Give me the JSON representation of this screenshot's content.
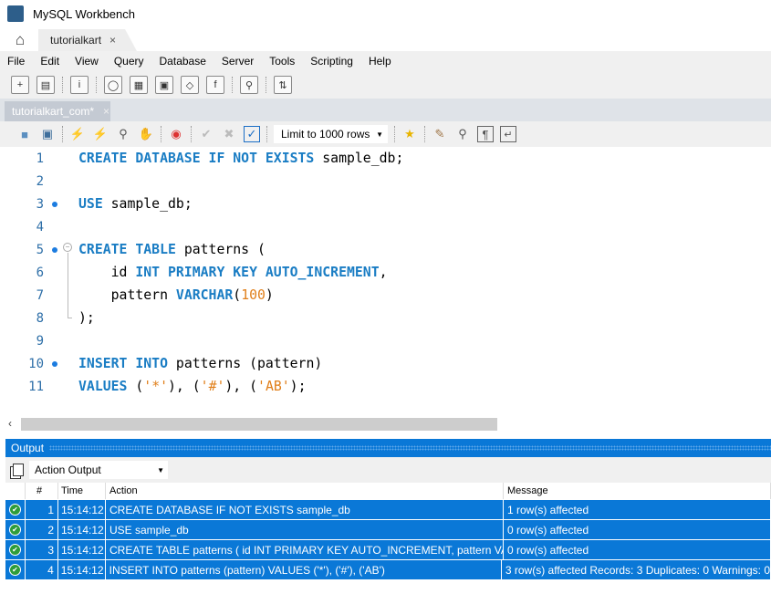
{
  "window": {
    "title": "MySQL Workbench"
  },
  "connection_tab": {
    "label": "tutorialkart",
    "close": "×"
  },
  "menu": [
    "File",
    "Edit",
    "View",
    "Query",
    "Database",
    "Server",
    "Tools",
    "Scripting",
    "Help"
  ],
  "editor_tab": {
    "label": "tutorialkart_com*",
    "close": "×"
  },
  "query_toolbar": {
    "limit_select": "Limit to 1000 rows"
  },
  "editor": {
    "lines": [
      {
        "n": "1",
        "bp": false,
        "tokens": [
          [
            "CREATE DATABASE IF NOT EXISTS",
            "kw"
          ],
          [
            " sample_db;",
            ""
          ]
        ]
      },
      {
        "n": "2",
        "bp": false,
        "tokens": []
      },
      {
        "n": "3",
        "bp": true,
        "tokens": [
          [
            "USE",
            "kw"
          ],
          [
            " sample_db;",
            ""
          ]
        ]
      },
      {
        "n": "4",
        "bp": false,
        "tokens": []
      },
      {
        "n": "5",
        "bp": true,
        "tokens": [
          [
            "CREATE TABLE",
            "kw"
          ],
          [
            " patterns (",
            ""
          ]
        ]
      },
      {
        "n": "6",
        "bp": false,
        "tokens": [
          [
            "    id ",
            ""
          ],
          [
            "INT PRIMARY KEY AUTO_INCREMENT",
            "kw"
          ],
          [
            ",",
            ""
          ]
        ]
      },
      {
        "n": "7",
        "bp": false,
        "tokens": [
          [
            "    pattern ",
            ""
          ],
          [
            "VARCHAR",
            "kw"
          ],
          [
            "(",
            ""
          ],
          [
            "100",
            "num"
          ],
          [
            ")",
            ""
          ]
        ]
      },
      {
        "n": "8",
        "bp": false,
        "tokens": [
          [
            ");",
            ""
          ]
        ]
      },
      {
        "n": "9",
        "bp": false,
        "tokens": []
      },
      {
        "n": "10",
        "bp": true,
        "tokens": [
          [
            "INSERT INTO",
            "kw"
          ],
          [
            " patterns (pattern)",
            ""
          ]
        ]
      },
      {
        "n": "11",
        "bp": false,
        "tokens": [
          [
            "VALUES",
            "kw"
          ],
          [
            " (",
            ""
          ],
          [
            "'*'",
            "str"
          ],
          [
            "), (",
            ""
          ],
          [
            "'#'",
            "str"
          ],
          [
            "), (",
            ""
          ],
          [
            "'AB'",
            "str"
          ],
          [
            ");",
            ""
          ]
        ]
      }
    ]
  },
  "output": {
    "title": "Output",
    "selector": "Action Output",
    "columns": [
      "#",
      "Time",
      "Action",
      "Message"
    ],
    "rows": [
      {
        "num": "1",
        "time": "15:14:12",
        "action": "CREATE DATABASE IF NOT EXISTS sample_db",
        "message": "1 row(s) affected",
        "status": "success"
      },
      {
        "num": "2",
        "time": "15:14:12",
        "action": "USE sample_db",
        "message": "0 row(s) affected",
        "status": "success"
      },
      {
        "num": "3",
        "time": "15:14:12",
        "action": "CREATE TABLE patterns (     id INT PRIMARY KEY AUTO_INCREMENT,     pattern VA...",
        "message": "0 row(s) affected",
        "status": "success"
      },
      {
        "num": "4",
        "time": "15:14:12",
        "action": "INSERT INTO patterns (pattern) VALUES ('*'), ('#'), ('AB')",
        "message": "3 row(s) affected Records: 3  Duplicates: 0  Warnings: 0",
        "status": "success"
      }
    ]
  },
  "colors": {
    "accent": "#0a78d7",
    "keyword": "#1a7dc4",
    "literal": "#e07f1a",
    "success": "#2e9c3a"
  }
}
